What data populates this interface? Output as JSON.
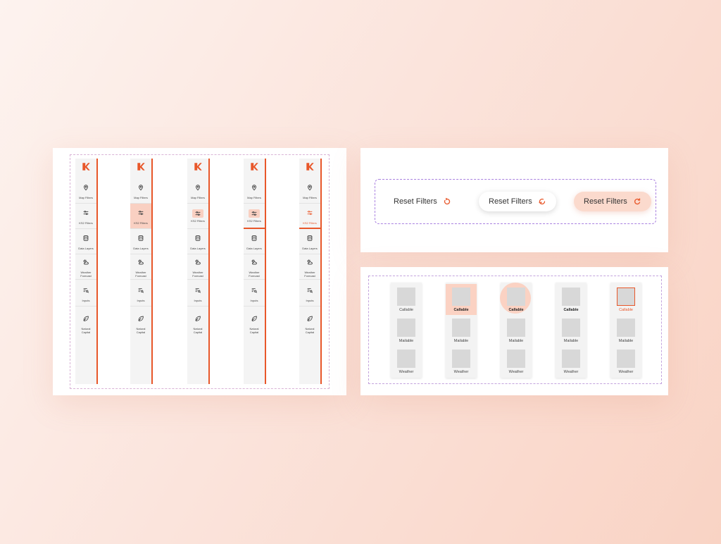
{
  "nav_items": [
    {
      "label": "Map Filters",
      "icon": "map-pin-icon"
    },
    {
      "label": "KS2 Filters",
      "icon": "sliders-icon"
    },
    {
      "label": "Data Layers",
      "icon": "database-icon"
    },
    {
      "label": "Weather\nForecast",
      "icon": "weather-icon"
    },
    {
      "label": "Inputs",
      "icon": "list-search-icon"
    },
    {
      "label": "Natural\nCapital",
      "icon": "leaf-icon"
    }
  ],
  "reset": {
    "label_1": "Reset Filters",
    "label_2": "Reset Filters",
    "label_3": "Reset Filters"
  },
  "items": [
    {
      "label": "Callable"
    },
    {
      "label": "Mailable"
    },
    {
      "label": "Weather"
    }
  ],
  "colors": {
    "accent": "#e8572a",
    "selection": "#f9d0c2",
    "dash_pink": "#d9b3d6",
    "dash_purple": "#a980e0"
  }
}
